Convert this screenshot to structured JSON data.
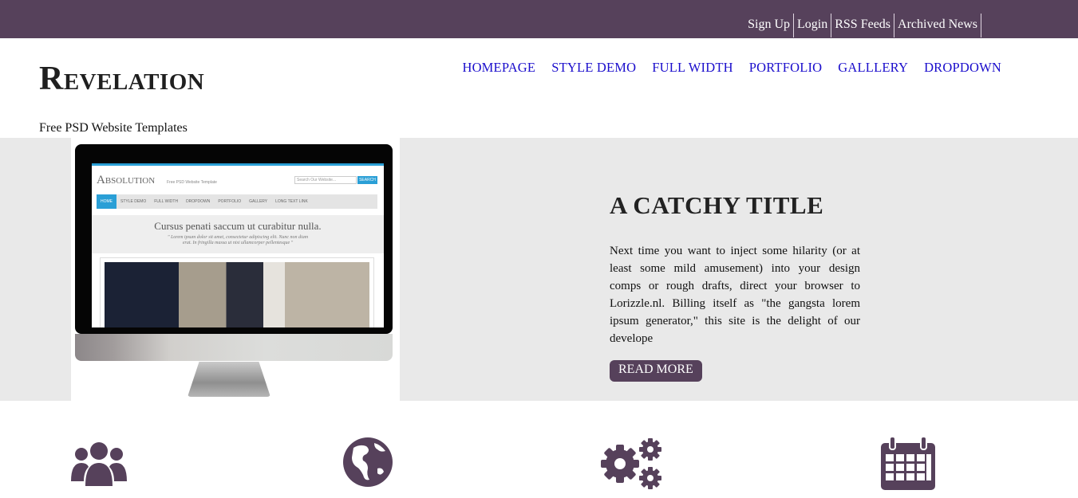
{
  "topbar": {
    "links": [
      "Sign Up",
      "Login",
      "RSS Feeds",
      "Archived News"
    ]
  },
  "header": {
    "logo": "Revelation",
    "tagline": "Free PSD Website Templates",
    "nav": [
      "HOMEPAGE",
      "STYLE DEMO",
      "FULL WIDTH",
      "PORTFOLIO",
      "GALLLERY",
      "DROPDOWN"
    ]
  },
  "preview": {
    "logo": "Absolution",
    "subtitle": "Free PSD Website Template",
    "search_placeholder": "Search Our Website...",
    "search_button": "SEARCH",
    "nav": [
      "HOME",
      "STYLE DEMO",
      "FULL WIDTH",
      "DROPDOWN",
      "PORTFOLIO",
      "GALLERY",
      "LONG TEXT LINK"
    ],
    "heading": "Cursus penati saccum ut curabitur nulla.",
    "quote_line1": "\" Lorem ipsum dolor sit amet, consectetur adipiscing elit. Nunc non diam",
    "quote_line2": "erat. In fringilla massa ut nisi ullamcorper pellentesque \""
  },
  "hero": {
    "title": "A CATCHY TITLE",
    "text": "Next time you want to inject some hilarity (or at least some mild amusement) into your design comps or rough drafts, direct your browser to Lorizzle.nl. Billing itself as \"the gangsta lorem ipsum generator,\" this site is the delight of our develope",
    "button": "READ MORE"
  },
  "features": {
    "icons": [
      "users-icon",
      "globe-icon",
      "gears-icon",
      "calendar-icon"
    ],
    "icon_color": "#56415b"
  },
  "colors": {
    "topbar": "#56415b",
    "nav_link": "#1a0dcc",
    "hero_bg": "#e9e9e9",
    "accent": "#2a9fd6"
  }
}
